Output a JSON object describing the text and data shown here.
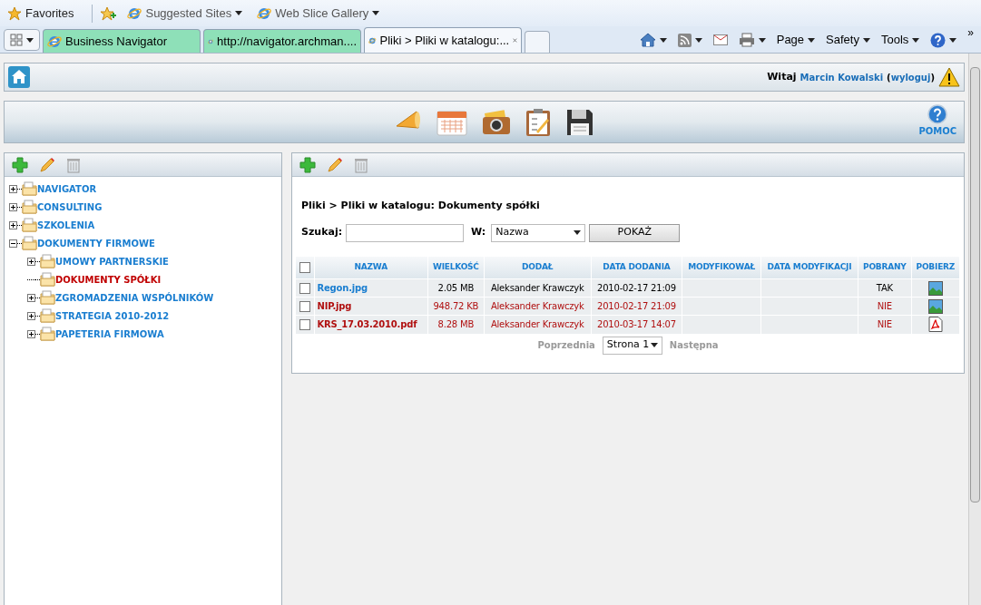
{
  "favorites_bar": {
    "favorites": "Favorites",
    "links": [
      "Suggested Sites",
      "Web Slice Gallery"
    ]
  },
  "tabs": [
    {
      "label": "Business Navigator",
      "selected": false,
      "color": "#8ee0b8"
    },
    {
      "label": "http://navigator.archman....",
      "selected": false,
      "color": "#8ee0b8"
    },
    {
      "label": "Pliki > Pliki w katalogu:...",
      "selected": true
    }
  ],
  "command_bar": {
    "menus": [
      "Page",
      "Safety",
      "Tools"
    ],
    "overflow": "»"
  },
  "header": {
    "greeting": "Witaj",
    "user": "Marcin Kowalski",
    "open_paren": "(",
    "logout": "wyloguj",
    "close_paren": ")"
  },
  "help": "POMOC",
  "tree": [
    {
      "label": "NAVIGATOR",
      "expanded": false,
      "selected": false
    },
    {
      "label": "CONSULTING",
      "expanded": false,
      "selected": false
    },
    {
      "label": "SZKOLENIA",
      "expanded": false,
      "selected": false
    },
    {
      "label": "DOKUMENTY FIRMOWE",
      "expanded": true,
      "selected": false,
      "children": [
        {
          "label": "UMOWY PARTNERSKIE",
          "expanded": false,
          "selected": false
        },
        {
          "label": "DOKUMENTY SPÓŁKI",
          "selected": true
        },
        {
          "label": "ZGROMADZENIA WSPÓLNIKÓW",
          "expanded": false,
          "selected": false
        },
        {
          "label": "STRATEGIA 2010-2012",
          "expanded": false,
          "selected": false
        },
        {
          "label": "PAPETERIA FIRMOWA",
          "expanded": false,
          "selected": false
        }
      ]
    }
  ],
  "breadcrumb": "Pliki > Pliki w katalogu: Dokumenty spółki",
  "search": {
    "label": "Szukaj:",
    "in_label": "W:",
    "in_value": "Nazwa",
    "button": "POKAŻ"
  },
  "table": {
    "all_checked": false,
    "columns": [
      "NAZWA",
      "WIELKOŚĆ",
      "DODAŁ",
      "DATA DODANIA",
      "MODYFIKOWAŁ",
      "DATA MODYFIKACJI",
      "POBRANY",
      "POBIERZ"
    ],
    "rows": [
      {
        "name": "Regon.jpg",
        "size": "2.05 MB",
        "added_by": "Aleksander Krawczyk",
        "added": "2010-02-17 21:09",
        "downloaded": "TAK",
        "is_downloaded": true,
        "checked": false,
        "kind": "image"
      },
      {
        "name": "NIP.jpg",
        "size": "948.72 KB",
        "added_by": "Aleksander Krawczyk",
        "added": "2010-02-17 21:09",
        "downloaded": "NIE",
        "is_downloaded": false,
        "checked": false,
        "kind": "image"
      },
      {
        "name": "KRS_17.03.2010.pdf",
        "size": "8.28 MB",
        "added_by": "Aleksander Krawczyk",
        "added": "2010-03-17 14:07",
        "downloaded": "NIE",
        "is_downloaded": false,
        "checked": false,
        "kind": "pdf"
      }
    ]
  },
  "pager": {
    "prev": "Poprzednia",
    "page": "Strona 1",
    "next": "Następna"
  }
}
